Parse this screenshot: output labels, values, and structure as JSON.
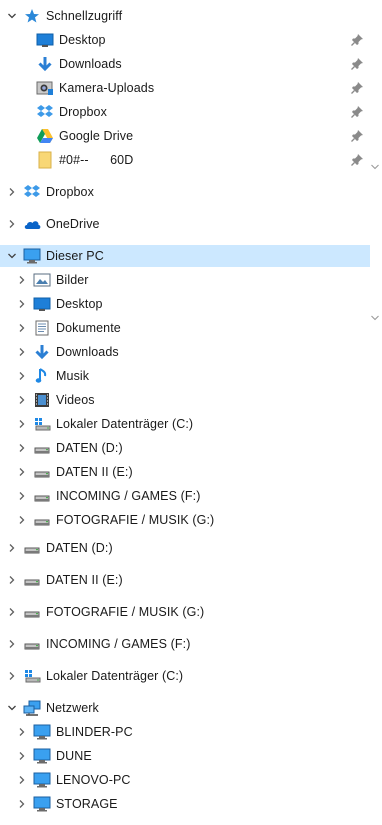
{
  "quick_access": {
    "label": "Schnellzugriff",
    "items": [
      {
        "label": "Desktop",
        "icon": "desktop-icon"
      },
      {
        "label": "Downloads",
        "icon": "downloads-icon"
      },
      {
        "label": "Kamera-Uploads",
        "icon": "camera-icon"
      },
      {
        "label": "Dropbox",
        "icon": "dropbox-icon"
      },
      {
        "label": "Google Drive",
        "icon": "google-drive-icon"
      },
      {
        "label": "#0#--      60D",
        "icon": "folder-icon"
      }
    ]
  },
  "dropbox": {
    "label": "Dropbox",
    "icon": "dropbox-icon"
  },
  "onedrive": {
    "label": "OneDrive",
    "icon": "onedrive-icon"
  },
  "this_pc": {
    "label": "Dieser PC",
    "icon": "computer-icon",
    "children": [
      {
        "label": "Bilder",
        "icon": "pictures-icon"
      },
      {
        "label": "Desktop",
        "icon": "desktop-icon"
      },
      {
        "label": "Dokumente",
        "icon": "documents-icon"
      },
      {
        "label": "Downloads",
        "icon": "downloads-icon"
      },
      {
        "label": "Musik",
        "icon": "music-icon"
      },
      {
        "label": "Videos",
        "icon": "videos-icon"
      },
      {
        "label": "Lokaler Datenträger (C:)",
        "icon": "windows-drive-icon"
      },
      {
        "label": "DATEN (D:)",
        "icon": "drive-icon"
      },
      {
        "label": "DATEN II (E:)",
        "icon": "drive-icon"
      },
      {
        "label": "INCOMING / GAMES (F:)",
        "icon": "drive-icon"
      },
      {
        "label": "FOTOGRAFIE / MUSIK (G:)",
        "icon": "drive-icon"
      }
    ]
  },
  "drives": [
    {
      "label": "DATEN (D:)",
      "icon": "drive-icon"
    },
    {
      "label": "DATEN II (E:)",
      "icon": "drive-icon"
    },
    {
      "label": "FOTOGRAFIE / MUSIK (G:)",
      "icon": "drive-icon"
    },
    {
      "label": "INCOMING / GAMES (F:)",
      "icon": "drive-icon"
    },
    {
      "label": "Lokaler Datenträger (C:)",
      "icon": "windows-drive-icon"
    }
  ],
  "network": {
    "label": "Netzwerk",
    "icon": "network-icon",
    "children": [
      {
        "label": "BLINDER-PC",
        "icon": "computer-icon"
      },
      {
        "label": "DUNE",
        "icon": "computer-icon"
      },
      {
        "label": "LENOVO-PC",
        "icon": "computer-icon"
      },
      {
        "label": "STORAGE",
        "icon": "computer-icon"
      }
    ]
  },
  "colors": {
    "selection": "#cce8ff",
    "accent": "#0078d7",
    "text": "#1a1a1a"
  }
}
